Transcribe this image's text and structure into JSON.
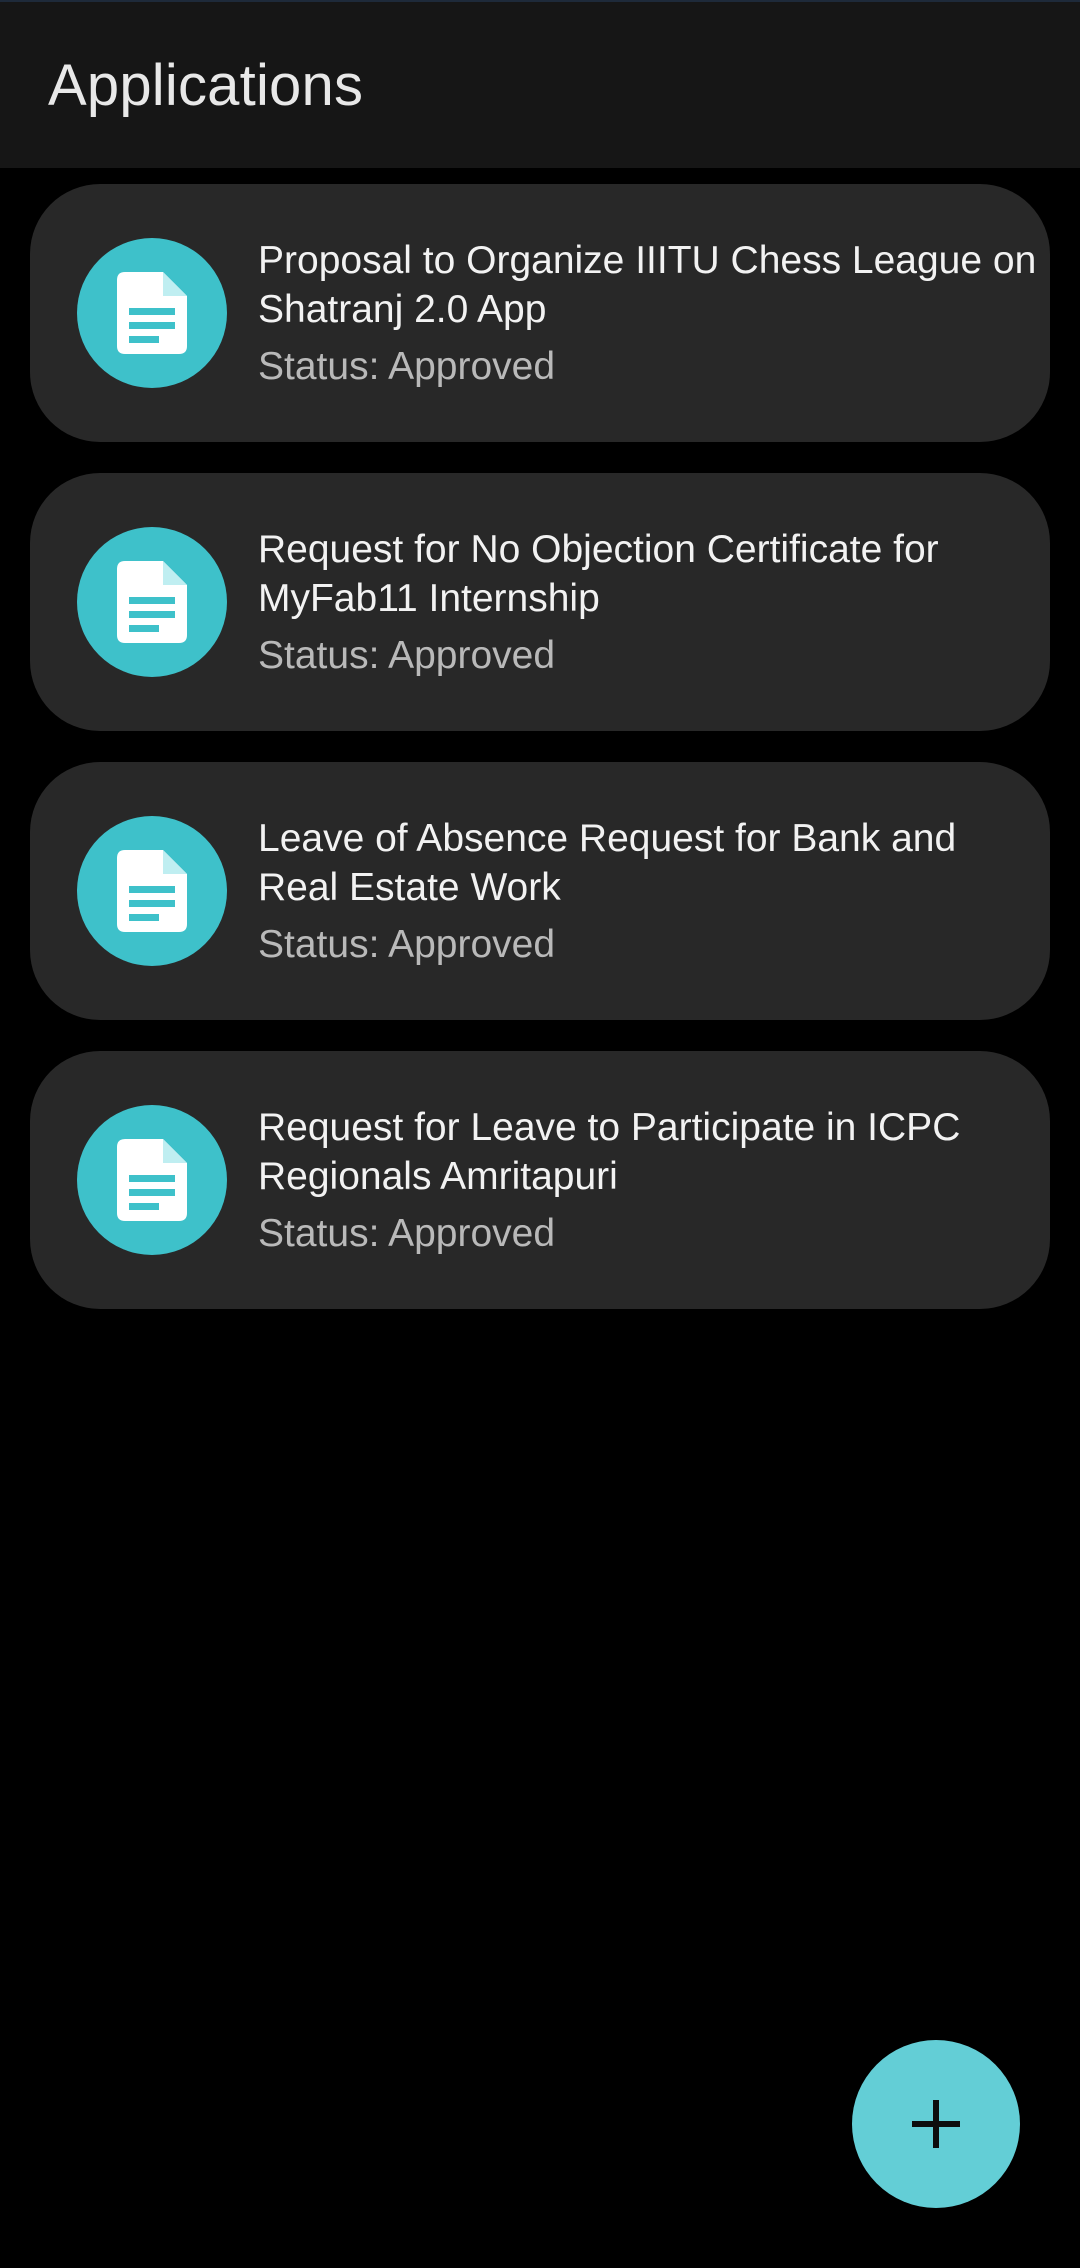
{
  "app_bar": {
    "title": "Applications"
  },
  "applications": [
    {
      "icon": "document-icon",
      "title": "Proposal to Organize IIITU Chess League on Shatranj 2.0 App",
      "status": "Status: Approved"
    },
    {
      "icon": "document-icon",
      "title": "Request for No Objection Certificate for MyFab11 Internship",
      "status": "Status: Approved"
    },
    {
      "icon": "document-icon",
      "title": "Leave of Absence Request for Bank and Real Estate Work",
      "status": "Status: Approved"
    },
    {
      "icon": "document-icon",
      "title": "Request for Leave to Participate in ICPC Regionals Amritapuri",
      "status": "Status: Approved"
    }
  ],
  "fab": {
    "icon": "plus-icon"
  },
  "colors": {
    "background": "#000000",
    "app_bar": "#161616",
    "card": "#282828",
    "accent": "#3ec1ca",
    "fab": "#63ced6",
    "status_text": "#b9b9b9"
  }
}
